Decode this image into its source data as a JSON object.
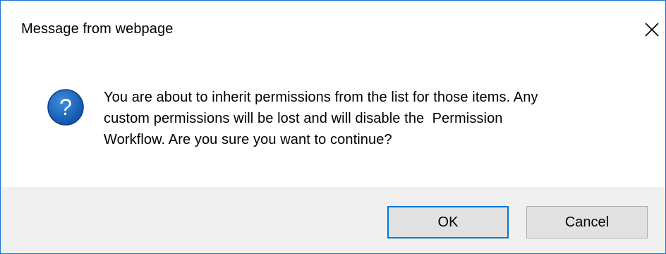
{
  "dialog": {
    "title": "Message from webpage",
    "close_icon": "close-icon",
    "icon": "question-icon",
    "message_lines": [
      "You are about to inherit permissions from the list for those items. Any",
      "custom permissions will be lost and will disable the  Permission",
      "Workflow. Are you sure you want to continue?"
    ],
    "buttons": {
      "ok": "OK",
      "cancel": "Cancel"
    }
  },
  "colors": {
    "border": "#1a73d9",
    "icon_blue": "#1565c0",
    "footer_bg": "#f0f0f0",
    "button_bg": "#e1e1e1",
    "default_button_border": "#0078d7"
  }
}
